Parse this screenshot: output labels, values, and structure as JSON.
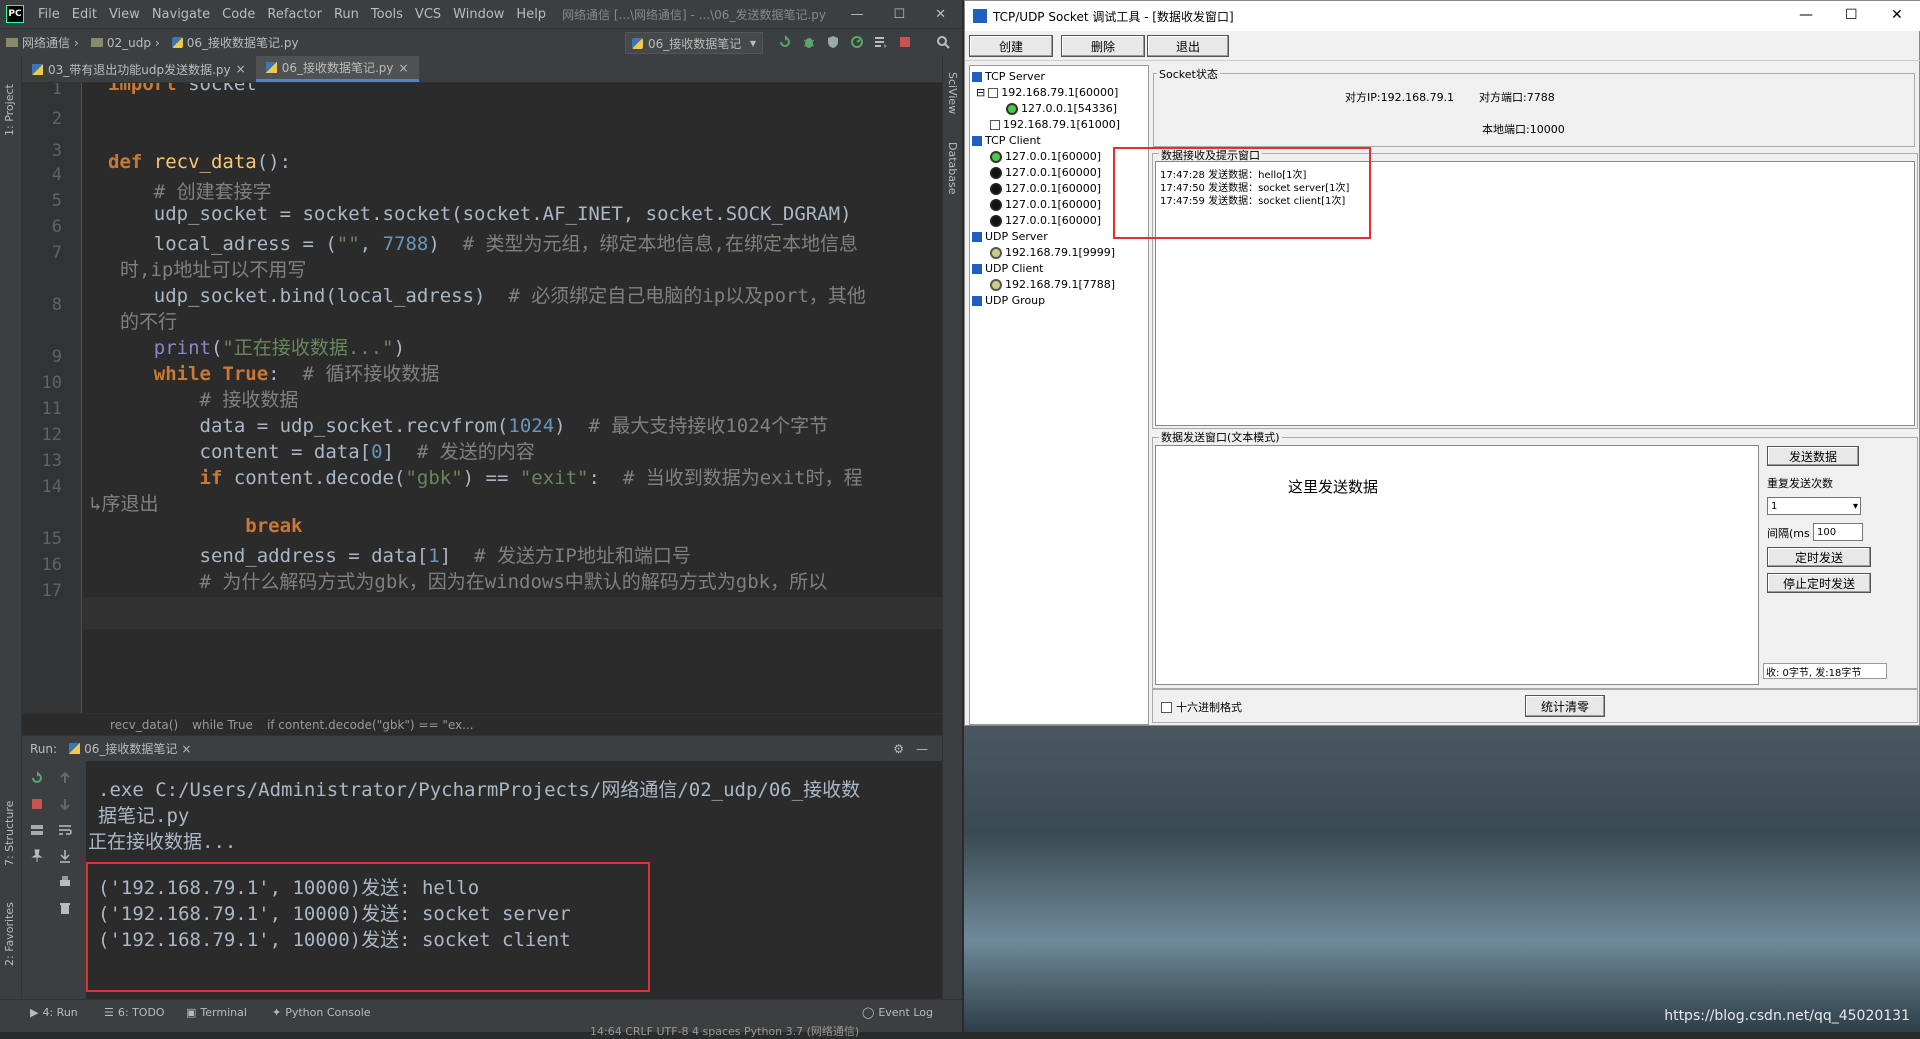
{
  "pycharm": {
    "logo": "PC",
    "menu": [
      "File",
      "Edit",
      "View",
      "Navigate",
      "Code",
      "Refactor",
      "Run",
      "Tools",
      "VCS",
      "Window",
      "Help"
    ],
    "window_title": "网络通信 [...\\网络通信] - ...\\06_发送数据笔记.py",
    "breadcrumbs": [
      "网络通信",
      "02_udp",
      "06_接收数据笔记.py"
    ],
    "run_config": "06_接收数据笔记",
    "tabs": [
      "03_带有退出功能udp发送数据.py",
      "06_接收数据笔记.py"
    ],
    "left_tool_labels": [
      "1: Project",
      "7: Structure",
      "2: Favorites"
    ],
    "right_tool_labels": [
      "SciView",
      "Database"
    ],
    "line_numbers": [
      "1",
      "2",
      "3",
      "4",
      "5",
      "6",
      "7",
      "8",
      "9",
      "10",
      "11",
      "12",
      "13",
      "14",
      "15",
      "16",
      "17"
    ],
    "code_breadcrumb": [
      "recv_data()",
      "while True",
      "if content.decode(\"gbk\") == \"ex..."
    ],
    "run_label": "Run:",
    "run_tab": "06_接收数据笔记",
    "console_lines": [
      ".exe C:/Users/Administrator/PycharmProjects/网络通信/02_udp/06_接收数",
      "据笔记.py",
      "正在接收数据...",
      "('192.168.79.1', 10000)发送: hello",
      "('192.168.79.1', 10000)发送: socket server",
      "('192.168.79.1', 10000)发送: socket client"
    ],
    "bottom_tabs": [
      "4: Run",
      "6: TODO",
      "Terminal",
      "Python Console"
    ],
    "event_log": "Event Log",
    "status": "14:64   CRLF   UTF-8   4 spaces   Python 3.7 (网络通信)"
  },
  "tool": {
    "title": "TCP/UDP Socket 调试工具 - [数据收发窗口]",
    "buttons": [
      "创建",
      "删除",
      "退出"
    ],
    "tree": {
      "tcp_server": "TCP Server",
      "tcp_server_items": [
        "192.168.79.1[60000]",
        "127.0.0.1[54336]",
        "192.168.79.1[61000]"
      ],
      "tcp_client": "TCP Client",
      "tcp_client_items": [
        "127.0.0.1[60000]",
        "127.0.0.1[60000]",
        "127.0.0.1[60000]",
        "127.0.0.1[60000]",
        "127.0.0.1[60000]"
      ],
      "udp_server": "UDP Server",
      "udp_server_items": [
        "192.168.79.1[9999]"
      ],
      "udp_client": "UDP Client",
      "udp_client_items": [
        "192.168.79.1[7788]"
      ],
      "udp_group": "UDP Group"
    },
    "socket_status_label": "Socket状态",
    "peer_ip": "对方IP:192.168.79.1",
    "peer_port": "对方端口:7788",
    "local_port": "本地端口:10000",
    "recv_label": "数据接收及提示窗口",
    "recv_lines": [
      "17:47:28 发送数据：hello[1次]",
      "17:47:50 发送数据：socket server[1次]",
      "17:47:59 发送数据：socket client[1次]"
    ],
    "send_label": "数据发送窗口(文本模式)",
    "send_text": "这里发送数据",
    "send_button": "发送数据",
    "repeat_label": "重复发送次数",
    "repeat_value": "1",
    "interval_label": "间隔(ms",
    "interval_value": "100",
    "timer_button": "定时发送",
    "stop_timer_button": "停止定时发送",
    "stats": "收: 0字节, 发:18字节",
    "hex_label": "十六进制格式",
    "clear_button": "统计清零"
  },
  "watermark": "https://blog.csdn.net/qq_45020131"
}
